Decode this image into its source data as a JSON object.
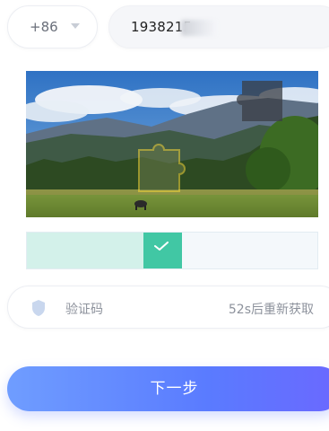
{
  "phone_form": {
    "country_code": "+86",
    "phone_number_visible": "1938215"
  },
  "captcha": {
    "progress": 0.4
  },
  "verification": {
    "placeholder": "验证码",
    "resend_countdown": "52s后重新获取"
  },
  "actions": {
    "next_label": "下一步"
  },
  "colors": {
    "slider_success": "#41c7a4",
    "slider_fill": "#d3f1ea",
    "button_gradient_start": "#6f9dff",
    "button_gradient_end": "#6b68ff",
    "piece_outline": "#f3d43a"
  }
}
